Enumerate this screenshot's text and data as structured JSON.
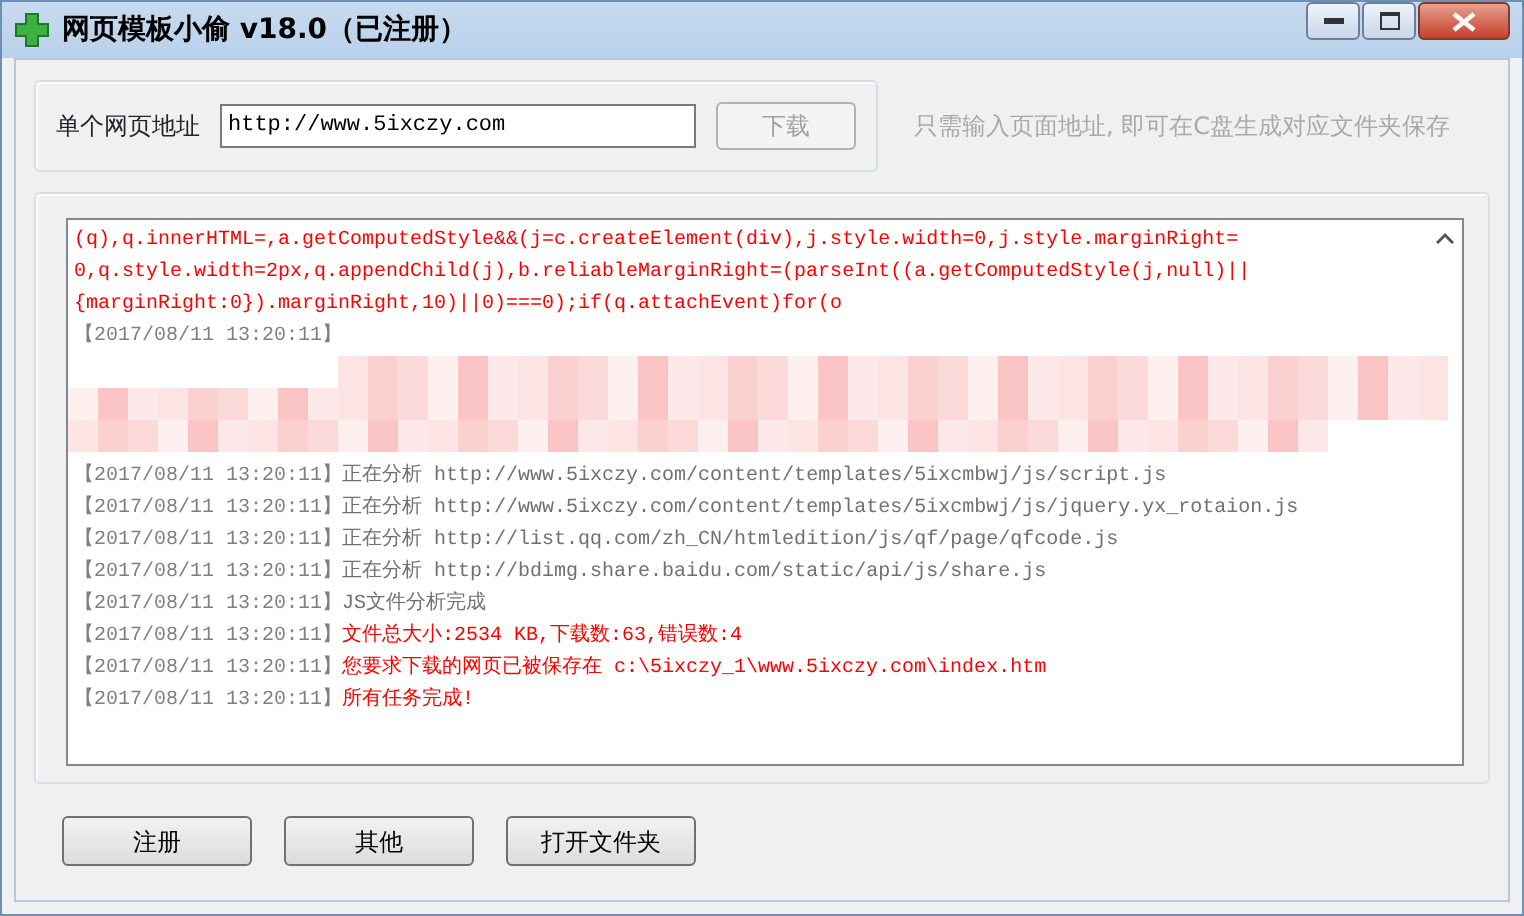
{
  "window": {
    "title": "网页模板小偷 v18.0（已注册）"
  },
  "url_group": {
    "label": "单个网页地址",
    "value": "http://www.5ixczy.com",
    "download_button": {
      "label": "下载",
      "disabled": true
    },
    "hint": "只需输入页面地址, 即可在C盘生成对应文件夹保存"
  },
  "log": {
    "code_lines": [
      "(q),q.innerHTML=,a.getComputedStyle&&(j=c.createElement(div),j.style.width=0,j.style.marginRight=",
      "0,q.style.width=2px,q.appendChild(j),b.reliableMarginRight=(parseInt((a.getComputedStyle(j,null)||",
      "{marginRight:0}).marginRight,10)||0)===0);if(q.attachEvent)for(o"
    ],
    "redacted_timestamp": "【2017/08/11 13:20:11】",
    "entries": [
      {
        "time": "【2017/08/11 13:20:11】",
        "message": "正在分析 http://www.5ixczy.com/content/templates/5ixcmbwj/js/script.js",
        "kind": "normal"
      },
      {
        "time": "【2017/08/11 13:20:11】",
        "message": "正在分析 http://www.5ixczy.com/content/templates/5ixcmbwj/js/jquery.yx_rotaion.js",
        "kind": "normal"
      },
      {
        "time": "【2017/08/11 13:20:11】",
        "message": "正在分析 http://list.qq.com/zh_CN/htmledition/js/qf/page/qfcode.js",
        "kind": "normal"
      },
      {
        "time": "【2017/08/11 13:20:11】",
        "message": "正在分析 http://bdimg.share.baidu.com/static/api/js/share.js",
        "kind": "normal"
      },
      {
        "time": "【2017/08/11 13:20:11】",
        "message": "JS文件分析完成",
        "kind": "normal"
      },
      {
        "time": "【2017/08/11 13:20:11】",
        "message": "文件总大小:2534 KB,下载数:63,错误数:4",
        "kind": "alert"
      },
      {
        "time": "【2017/08/11 13:20:11】",
        "message": "您要求下载的网页已被保存在 c:\\5ixczy_1\\www.5ixczy.com\\index.htm",
        "kind": "alert"
      },
      {
        "time": "【2017/08/11 13:20:11】",
        "message": "所有任务完成!",
        "kind": "alert"
      }
    ]
  },
  "buttons": [
    "注册",
    "其他",
    "打开文件夹"
  ]
}
